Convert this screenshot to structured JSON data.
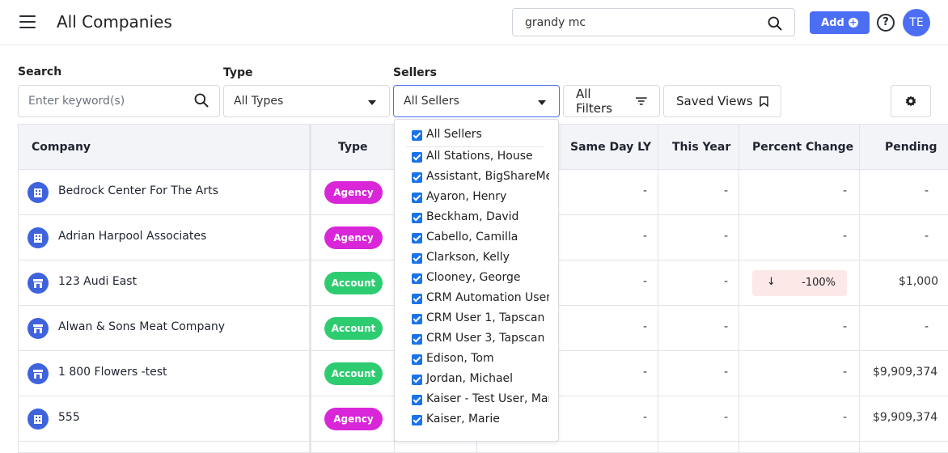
{
  "header": {
    "title": "All Companies",
    "search_value": "grandy mc",
    "add_label": "Add",
    "help_glyph": "?",
    "avatar_initials": "TE"
  },
  "filters": {
    "search_label": "Search",
    "search_placeholder": "Enter keyword(s)",
    "type_label": "Type",
    "type_value": "All Types",
    "sellers_label": "Sellers",
    "sellers_value": "All Sellers",
    "all_filters_label": "All Filters",
    "saved_views_label": "Saved Views"
  },
  "table": {
    "columns": [
      "Company",
      "Type",
      "Same Day LY",
      "This Year",
      "Percent Change",
      "Pending"
    ],
    "rows": [
      {
        "company": "Bedrock Center For The Arts",
        "type": "Agency",
        "icon": "building-icon",
        "same_day_ly": "-",
        "this_year": "-",
        "pct": "-",
        "pending": "-"
      },
      {
        "company": "Adrian Harpool Associates",
        "type": "Agency",
        "icon": "building-icon",
        "same_day_ly": "-",
        "this_year": "-",
        "pct": "-",
        "pending": "-"
      },
      {
        "company": "123 Audi East",
        "type": "Account",
        "icon": "store-icon",
        "same_day_ly": "-",
        "this_year": "-",
        "pct": "-100%",
        "pending": "$1,000"
      },
      {
        "company": "Alwan & Sons Meat Company",
        "type": "Account",
        "icon": "store-icon",
        "same_day_ly": "-",
        "this_year": "-",
        "pct": "-",
        "pending": "-"
      },
      {
        "company": "1 800 Flowers -test",
        "type": "Account",
        "icon": "store-icon",
        "same_day_ly": "-",
        "this_year": "-",
        "pct": "-",
        "pending": "$9,909,374"
      },
      {
        "company": "555",
        "type": "Agency",
        "icon": "building-icon",
        "same_day_ly": "-",
        "this_year": "-",
        "pct": "-",
        "pending": "$9,909,374"
      }
    ]
  },
  "sellers_dropdown": {
    "options": [
      "All Sellers",
      "All Stations, House",
      "Assistant, BigShareMe",
      "Ayaron, Henry",
      "Beckham, David",
      "Cabello, Camilla",
      "Clarkson, Kelly",
      "Clooney, George",
      "CRM Automation User,",
      "CRM User 1, Tapscan",
      "CRM User 3, Tapscan",
      "Edison, Tom",
      "Jordan, Michael",
      "Kaiser - Test User, Mar",
      "Kaiser, Marie"
    ]
  },
  "colors": {
    "primary": "#4c6ef5",
    "agency": "#d926d9",
    "account": "#2ecc71",
    "decrease_bg": "#fde8e8"
  }
}
